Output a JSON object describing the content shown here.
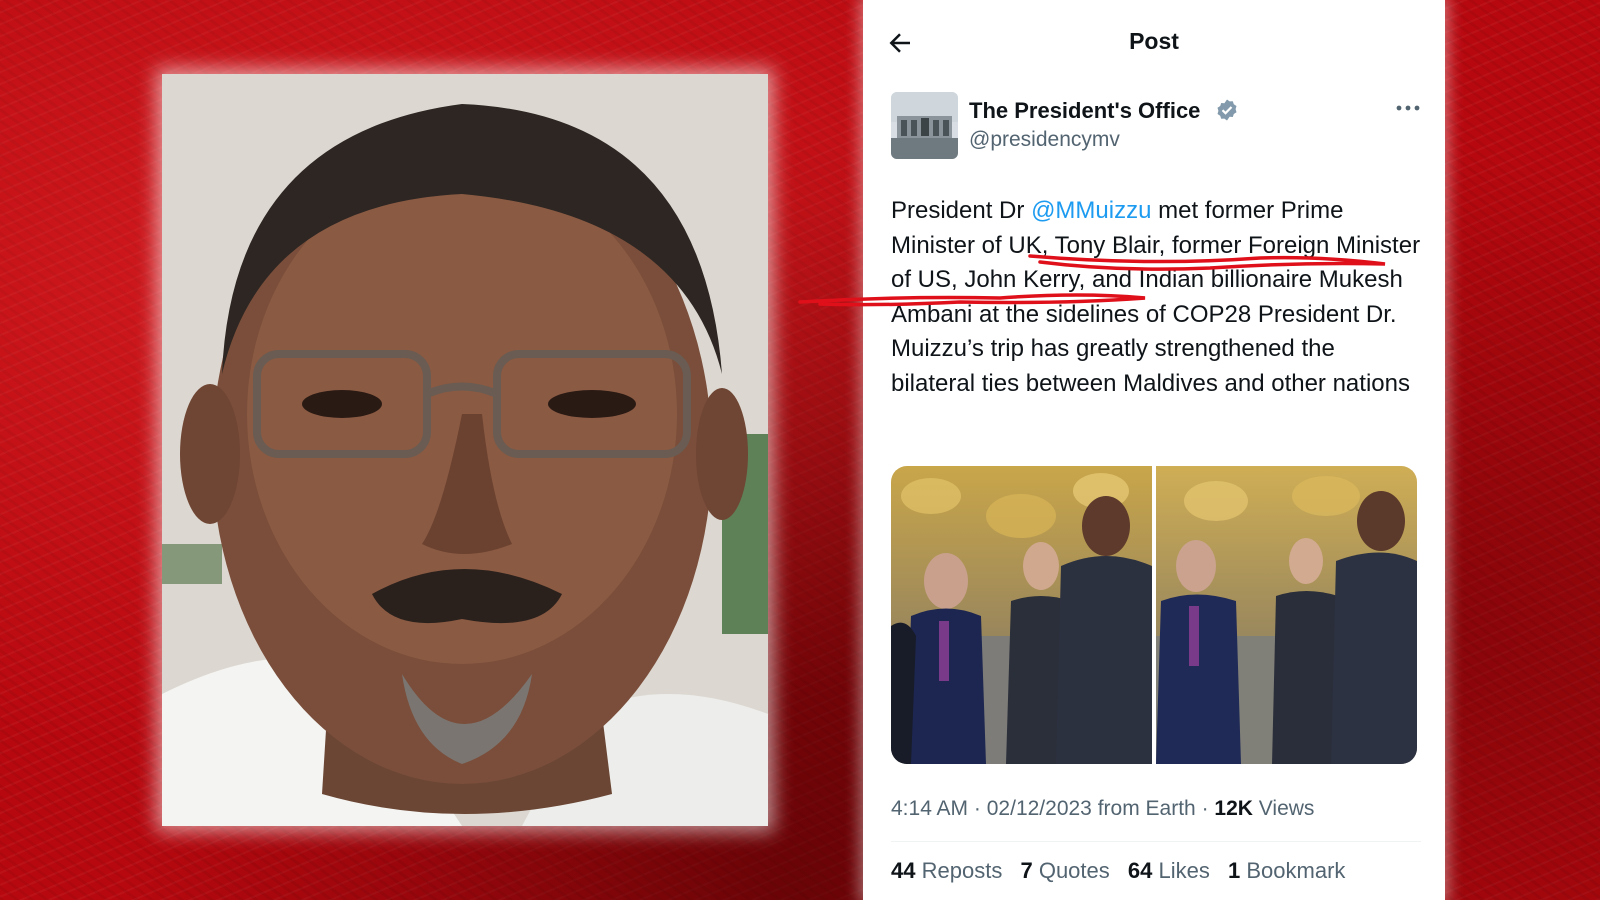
{
  "header": {
    "title": "Post"
  },
  "author": {
    "name": "The President's Office",
    "handle": "@presidencymv"
  },
  "tweet": {
    "text_before": "President Dr ",
    "mention": "@MMuizzu",
    "text_after": " met former Prime Minister of UK, Tony Blair, former Foreign Minister of US, John Kerry, and Indian billionaire Mukesh Ambani at the sidelines of COP28 President Dr. Muizzu’s trip has greatly strengthened the bilateral ties between Maldives and other nations"
  },
  "meta": {
    "time": "4:14 AM",
    "separator": "·",
    "date": "02/12/2023",
    "source": "from Earth",
    "views_count": "12K",
    "views_label": "Views"
  },
  "stats": {
    "reposts_count": "44",
    "reposts_label": "Reposts",
    "quotes_count": "7",
    "quotes_label": "Quotes",
    "likes_count": "64",
    "likes_label": "Likes",
    "bookmarks_count": "1",
    "bookmarks_label": "Bookmark"
  },
  "colors": {
    "background_red": "#b8080f",
    "link_blue": "#1d9bf0",
    "secondary_text": "#536471",
    "annotation_red": "#e0101a"
  },
  "icons": {
    "back": "arrow-left-icon",
    "verified": "verified-badge-icon",
    "more": "more-dots-icon"
  }
}
